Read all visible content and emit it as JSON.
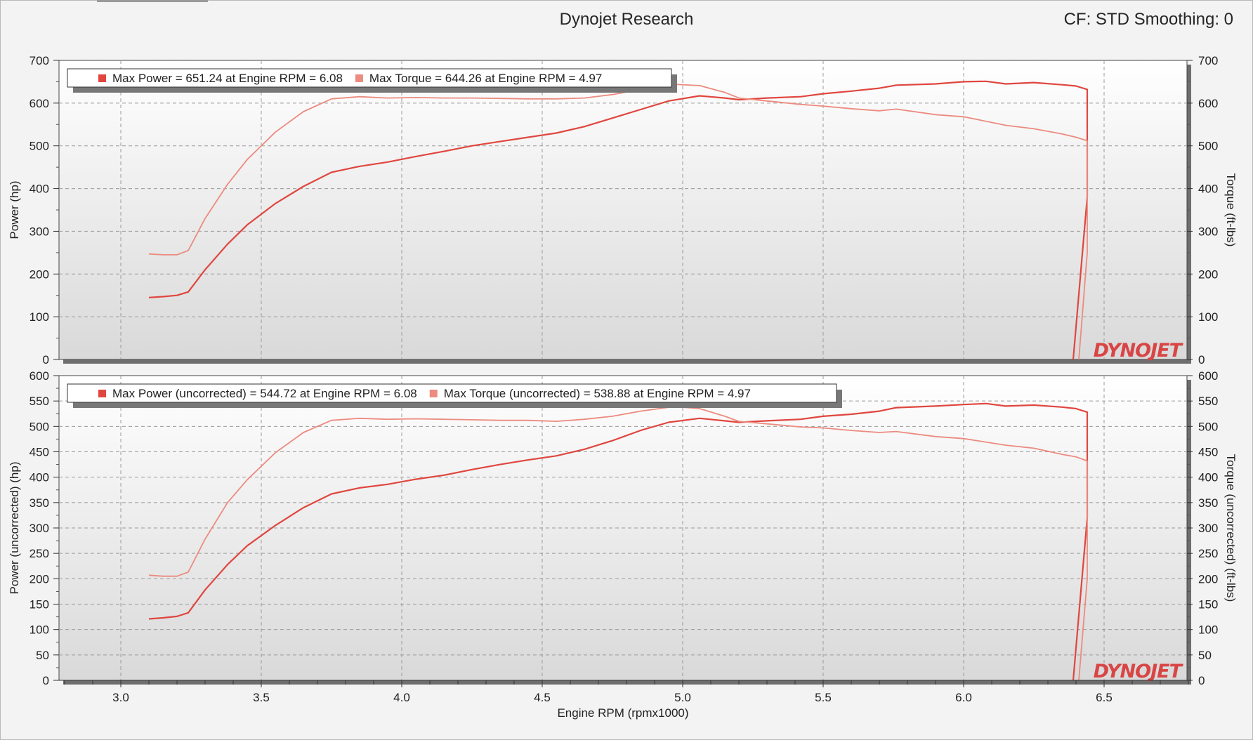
{
  "header": {
    "title": "Dynojet Research",
    "cf_label": "CF: STD Smoothing: 0"
  },
  "colors": {
    "power": "#e0463f",
    "torque": "#ec8b80",
    "logo": "#d94545"
  },
  "xaxis": {
    "label": "Engine RPM (rpmx1000)",
    "ticks": [
      "3.0",
      "3.5",
      "4.0",
      "4.5",
      "5.0",
      "5.5",
      "6.0",
      "6.5"
    ],
    "range": [
      2.78,
      6.795
    ]
  },
  "logo_text": "DYNOJET",
  "chart_data": [
    {
      "type": "line",
      "ylabel": "Power (hp)",
      "y2label": "Torque (ft-lbs)",
      "ylim": [
        0,
        700
      ],
      "yticks": [
        "0",
        "100",
        "200",
        "300",
        "400",
        "500",
        "600",
        "700"
      ],
      "legend": [
        {
          "marker": "power",
          "text": "Max Power = 651.24 at Engine RPM = 6.08"
        },
        {
          "marker": "torque",
          "text": "Max Torque = 644.26 at Engine RPM = 4.97"
        }
      ],
      "series": [
        {
          "name": "Power",
          "x": [
            3.1,
            3.15,
            3.2,
            3.24,
            3.3,
            3.38,
            3.45,
            3.55,
            3.65,
            3.75,
            3.85,
            3.95,
            4.05,
            4.15,
            4.25,
            4.35,
            4.45,
            4.55,
            4.65,
            4.75,
            4.85,
            4.95,
            5.06,
            5.15,
            5.2,
            5.3,
            5.42,
            5.5,
            5.6,
            5.7,
            5.76,
            5.9,
            6.0,
            6.08,
            6.15,
            6.25,
            6.35,
            6.4,
            6.44,
            6.44,
            6.39
          ],
          "y": [
            145,
            147,
            150,
            158,
            210,
            270,
            315,
            365,
            405,
            438,
            452,
            462,
            475,
            487,
            500,
            510,
            520,
            530,
            545,
            565,
            585,
            605,
            617,
            612,
            608,
            612,
            615,
            622,
            628,
            635,
            642,
            645,
            650,
            651,
            645,
            648,
            643,
            640,
            632,
            380,
            0
          ]
        },
        {
          "name": "Torque",
          "x": [
            3.1,
            3.15,
            3.2,
            3.24,
            3.3,
            3.38,
            3.45,
            3.55,
            3.65,
            3.75,
            3.85,
            3.95,
            4.05,
            4.15,
            4.25,
            4.35,
            4.45,
            4.55,
            4.65,
            4.75,
            4.85,
            4.97,
            5.06,
            5.15,
            5.2,
            5.3,
            5.42,
            5.5,
            5.6,
            5.7,
            5.76,
            5.9,
            6.0,
            6.15,
            6.25,
            6.35,
            6.4,
            6.44,
            6.44,
            6.41
          ],
          "y": [
            247,
            245,
            245,
            255,
            330,
            410,
            468,
            532,
            580,
            610,
            615,
            612,
            613,
            612,
            612,
            611,
            610,
            610,
            612,
            620,
            632,
            644,
            641,
            625,
            612,
            605,
            597,
            593,
            587,
            582,
            586,
            573,
            568,
            548,
            540,
            528,
            520,
            512,
            250,
            0
          ]
        }
      ]
    },
    {
      "type": "line",
      "ylabel": "Power (uncorrected) (hp)",
      "y2label": "Torque (uncorrected) (ft-lbs)",
      "ylim": [
        0,
        600
      ],
      "yticks": [
        "0",
        "50",
        "100",
        "150",
        "200",
        "250",
        "300",
        "350",
        "400",
        "450",
        "500",
        "550",
        "600"
      ],
      "legend": [
        {
          "marker": "power",
          "text": "Max Power (uncorrected) = 544.72 at Engine RPM = 6.08"
        },
        {
          "marker": "torque",
          "text": "Max Torque (uncorrected) = 538.88 at Engine RPM = 4.97"
        }
      ],
      "series": [
        {
          "name": "Power (uncorrected)",
          "x": [
            3.1,
            3.15,
            3.2,
            3.24,
            3.3,
            3.38,
            3.45,
            3.55,
            3.65,
            3.75,
            3.85,
            3.95,
            4.05,
            4.15,
            4.25,
            4.35,
            4.45,
            4.55,
            4.65,
            4.75,
            4.85,
            4.95,
            5.06,
            5.15,
            5.2,
            5.3,
            5.42,
            5.5,
            5.6,
            5.7,
            5.76,
            5.9,
            6.0,
            6.08,
            6.15,
            6.25,
            6.35,
            6.4,
            6.44,
            6.44,
            6.39
          ],
          "y": [
            121,
            123,
            126,
            133,
            178,
            228,
            265,
            305,
            340,
            367,
            379,
            386,
            396,
            404,
            415,
            425,
            434,
            442,
            455,
            472,
            492,
            508,
            516,
            511,
            508,
            511,
            514,
            520,
            524,
            530,
            537,
            540,
            543,
            545,
            540,
            542,
            538,
            535,
            528,
            320,
            0
          ]
        },
        {
          "name": "Torque (uncorrected)",
          "x": [
            3.1,
            3.15,
            3.2,
            3.24,
            3.3,
            3.38,
            3.45,
            3.55,
            3.65,
            3.75,
            3.85,
            3.95,
            4.05,
            4.15,
            4.25,
            4.35,
            4.45,
            4.55,
            4.65,
            4.75,
            4.85,
            4.97,
            5.06,
            5.15,
            5.2,
            5.3,
            5.42,
            5.5,
            5.6,
            5.7,
            5.76,
            5.9,
            6.0,
            6.15,
            6.25,
            6.35,
            6.4,
            6.44,
            6.44,
            6.41
          ],
          "y": [
            207,
            205,
            205,
            213,
            278,
            350,
            395,
            448,
            488,
            512,
            516,
            514,
            515,
            514,
            513,
            512,
            512,
            510,
            514,
            520,
            530,
            539,
            535,
            520,
            510,
            505,
            499,
            497,
            492,
            488,
            490,
            480,
            476,
            463,
            457,
            445,
            440,
            432,
            200,
            0
          ]
        }
      ]
    }
  ]
}
